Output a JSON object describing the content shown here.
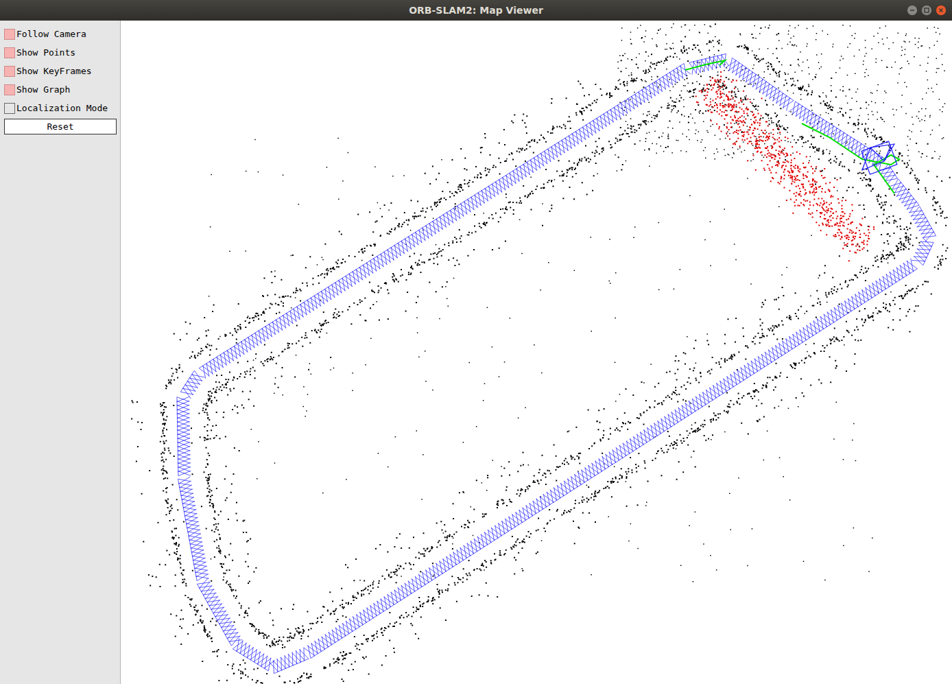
{
  "window": {
    "title": "ORB-SLAM2: Map Viewer"
  },
  "panel": {
    "options": [
      {
        "label": "Follow Camera",
        "checked": true
      },
      {
        "label": "Show Points",
        "checked": true
      },
      {
        "label": "Show KeyFrames",
        "checked": true
      },
      {
        "label": "Show Graph",
        "checked": true
      },
      {
        "label": "Localization Mode",
        "checked": false
      }
    ],
    "button": "Reset"
  }
}
